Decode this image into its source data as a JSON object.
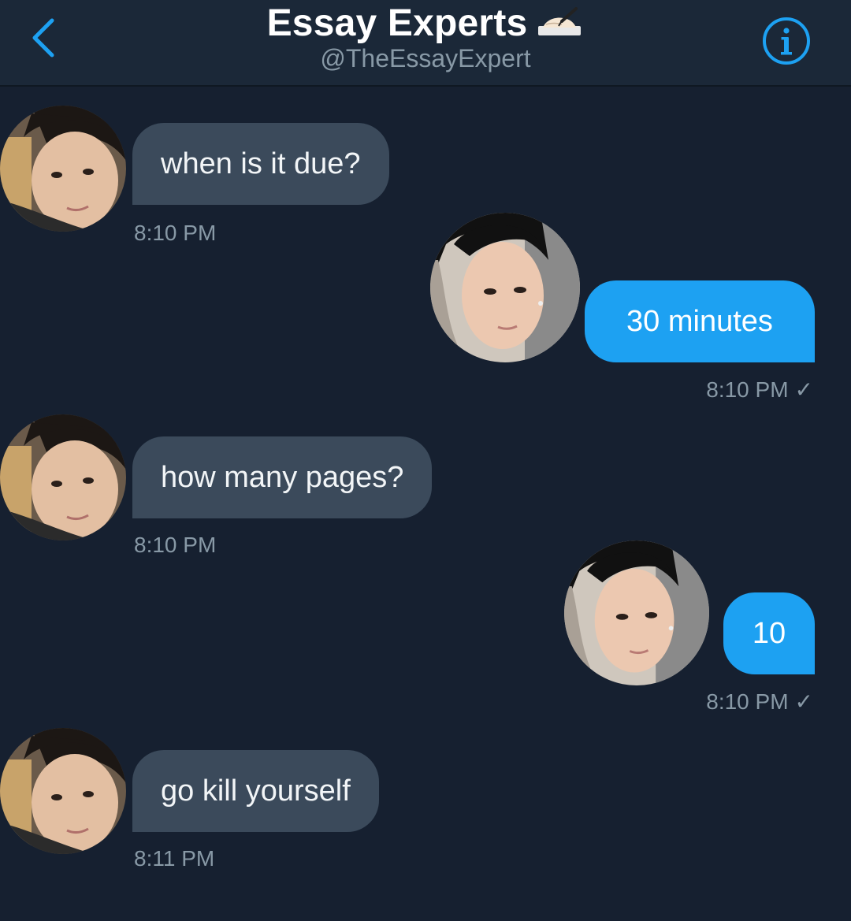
{
  "header": {
    "title": "Essay Experts",
    "title_emoji": "writing-hand-emoji",
    "handle": "@TheEssayExpert",
    "back_icon": "chevron-left-icon",
    "info_icon": "info-circle-icon",
    "accent": "#1da1f2"
  },
  "messages": [
    {
      "direction": "received",
      "text": "when is it due?",
      "time": "8:10 PM"
    },
    {
      "direction": "sent",
      "text": "30 minutes",
      "time": "8:10 PM",
      "read_mark": "✓"
    },
    {
      "direction": "received",
      "text": "how many pages?",
      "time": "8:10 PM"
    },
    {
      "direction": "sent",
      "text": "10",
      "time": "8:10 PM",
      "read_mark": "✓"
    },
    {
      "direction": "received",
      "text": "go kill yourself",
      "time": "8:11 PM"
    }
  ],
  "colors": {
    "background": "#162030",
    "header_bg": "#1b2838",
    "received_bubble": "#3b4a5b",
    "sent_bubble": "#1da1f2",
    "timestamp": "#8899a6"
  }
}
